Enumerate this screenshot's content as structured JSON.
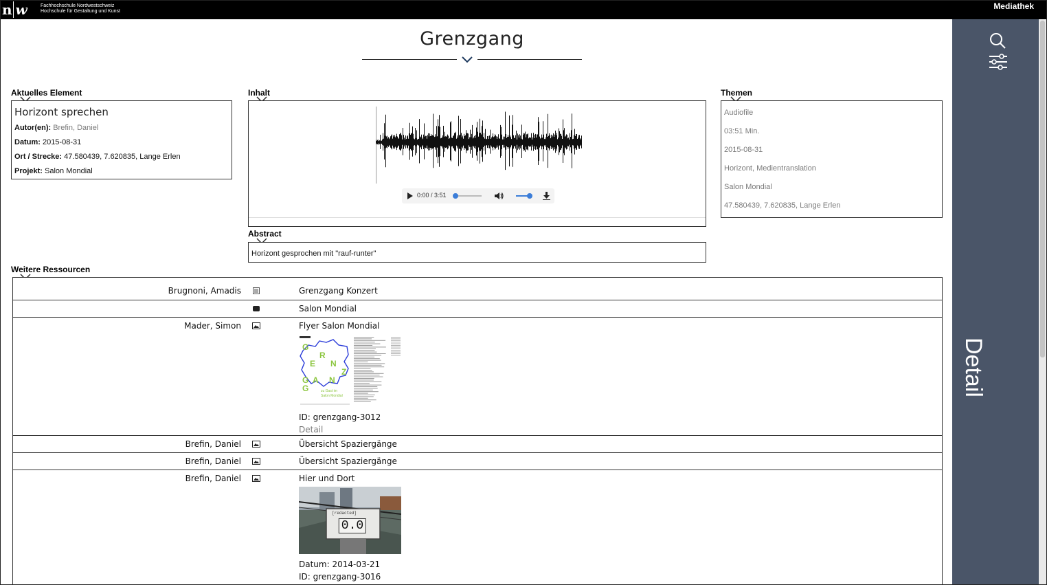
{
  "header": {
    "logo_mark_n": "n",
    "logo_mark_w": "w",
    "logo_line1": "Fachhochschule Nordwestschweiz",
    "logo_line2": "Hochschule für Gestaltung und Kunst",
    "mediathek": "Mediathek"
  },
  "sidebar": {
    "search_icon": "search-icon",
    "filter_icon": "sliders-icon",
    "detail_label": "Detail"
  },
  "page_title": "Grenzgang",
  "current_element": {
    "label": "Aktuelles Element",
    "title": "Horizont sprechen",
    "author_label": "Autor(en):",
    "author_value": "Brefin, Daniel",
    "date_label": "Datum:",
    "date_value": "2015-08-31",
    "place_label": "Ort / Strecke:",
    "place_value": "47.580439, 7.620835, Lange Erlen",
    "project_label": "Projekt:",
    "project_value": "Salon Mondial"
  },
  "inhalt": {
    "label": "Inhalt",
    "player_time": "0:00 / 3:51",
    "progress": 0.0,
    "volume": 1.0
  },
  "abstract": {
    "label": "Abstract",
    "text": "Horizont gesprochen mit \"rauf-runter\""
  },
  "themen": {
    "label": "Themen",
    "items": [
      "Audiofile",
      "03:51 Min.",
      "2015-08-31",
      "Horizont, Medientranslation",
      "Salon Mondial",
      "47.580439, 7.620835, Lange Erlen"
    ]
  },
  "resources": {
    "label": "Weitere Ressourcen",
    "rows": [
      {
        "author": "Brugnoni, Amadis",
        "icon": "document-icon",
        "title": "Grenzgang Konzert"
      },
      {
        "author": "",
        "icon": "folder-icon",
        "title": "Salon Mondial"
      },
      {
        "author": "Mader, Simon",
        "icon": "image-icon",
        "title": "Flyer Salon Mondial",
        "id": "ID: grenzgang-3012",
        "detail": "Detail"
      },
      {
        "author": "Brefin, Daniel",
        "icon": "image-icon",
        "title": "Übersicht Spaziergänge"
      },
      {
        "author": "Brefin, Daniel",
        "icon": "image-icon",
        "title": "Übersicht Spaziergänge"
      },
      {
        "author": "Brefin, Daniel",
        "icon": "image-icon",
        "title": "Hier und Dort",
        "date": "Datum: 2014-03-21",
        "id": "ID: grenzgang-3016"
      }
    ]
  },
  "flyer": {
    "letters": [
      "G",
      "R",
      "E",
      "N",
      "Z",
      "G",
      "A",
      "N",
      "G"
    ],
    "caption_line1": "zu Gast im",
    "caption_line2": "Salon Mondial"
  },
  "photo": {
    "sign_top": "[redacted]",
    "sign_value": "0.0"
  },
  "colors": {
    "sidebar": "#4a5568",
    "accent_blue": "#3b7dd8",
    "flyer_green": "#8cc63f",
    "flyer_blue": "#2a3bd9"
  }
}
